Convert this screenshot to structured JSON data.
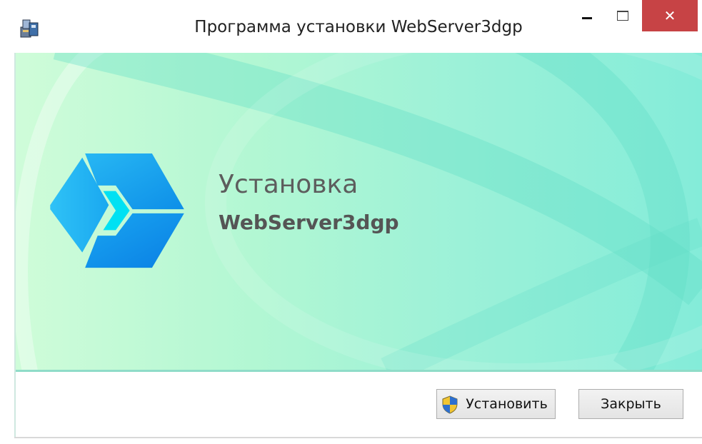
{
  "window": {
    "title": "Программа установки WebServer3dgp",
    "close_glyph": "✕"
  },
  "banner": {
    "heading": "Установка",
    "product": "WebServer3dgp",
    "logo_colors": [
      "#1fb2f5",
      "#0b88e8",
      "#00d9f0"
    ]
  },
  "buttons": {
    "install_label": "Установить",
    "close_label": "Закрыть"
  },
  "icons": [
    "installer-icon",
    "minimize-icon",
    "maximize-icon",
    "close-icon",
    "hexagon-logo-icon",
    "uac-shield-icon"
  ]
}
